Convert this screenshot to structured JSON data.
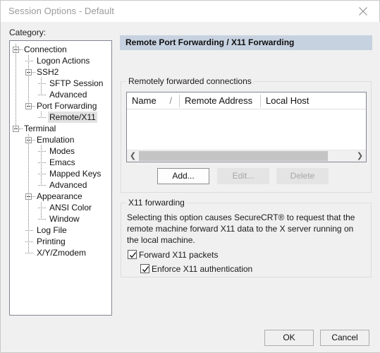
{
  "window": {
    "title": "Session Options - Default",
    "close_icon": "close-icon"
  },
  "category": {
    "label": "Category:",
    "selected": "Remote/X11",
    "items": [
      {
        "label": "Connection",
        "depth": 0,
        "expander": "minus"
      },
      {
        "label": "Logon Actions",
        "depth": 1,
        "expander": "none"
      },
      {
        "label": "SSH2",
        "depth": 1,
        "expander": "minus"
      },
      {
        "label": "SFTP Session",
        "depth": 2,
        "expander": "none"
      },
      {
        "label": "Advanced",
        "depth": 2,
        "expander": "none"
      },
      {
        "label": "Port Forwarding",
        "depth": 1,
        "expander": "minus"
      },
      {
        "label": "Remote/X11",
        "depth": 2,
        "expander": "none"
      },
      {
        "label": "Terminal",
        "depth": 0,
        "expander": "minus"
      },
      {
        "label": "Emulation",
        "depth": 1,
        "expander": "minus"
      },
      {
        "label": "Modes",
        "depth": 2,
        "expander": "none"
      },
      {
        "label": "Emacs",
        "depth": 2,
        "expander": "none"
      },
      {
        "label": "Mapped Keys",
        "depth": 2,
        "expander": "none"
      },
      {
        "label": "Advanced",
        "depth": 2,
        "expander": "none"
      },
      {
        "label": "Appearance",
        "depth": 1,
        "expander": "minus"
      },
      {
        "label": "ANSI Color",
        "depth": 2,
        "expander": "none"
      },
      {
        "label": "Window",
        "depth": 2,
        "expander": "none"
      },
      {
        "label": "Log File",
        "depth": 1,
        "expander": "none"
      },
      {
        "label": "Printing",
        "depth": 1,
        "expander": "none"
      },
      {
        "label": "X/Y/Zmodem",
        "depth": 1,
        "expander": "none"
      }
    ]
  },
  "banner": {
    "title": "Remote Port Forwarding / X11 Forwarding"
  },
  "remote_group": {
    "legend": "Remotely forwarded connections",
    "columns": [
      {
        "label": "Name",
        "sort_indicator": "/"
      },
      {
        "label": "Remote Address",
        "sort_indicator": ""
      },
      {
        "label": "Local Host",
        "sort_indicator": ""
      }
    ],
    "rows": [],
    "scrollbar": {
      "left_arrow": "❮",
      "right_arrow": "❯"
    },
    "buttons": {
      "add": "Add...",
      "edit": "Edit...",
      "delete": "Delete"
    }
  },
  "x11_group": {
    "legend": "X11 forwarding",
    "description": "Selecting this option causes SecureCRT® to request that the remote machine forward X11 data to the X server running on the local machine.",
    "forward_checkbox": {
      "label": "Forward X11 packets",
      "checked": true
    },
    "enforce_checkbox": {
      "label": "Enforce X11 authentication",
      "checked": true
    }
  },
  "dialog_buttons": {
    "ok": "OK",
    "cancel": "Cancel"
  },
  "colors": {
    "banner_bg": "#c7d2e0",
    "dialog_bg": "#f0f0f0",
    "field_bg": "#ffffff",
    "selection_bg": "#e2e2e2"
  }
}
